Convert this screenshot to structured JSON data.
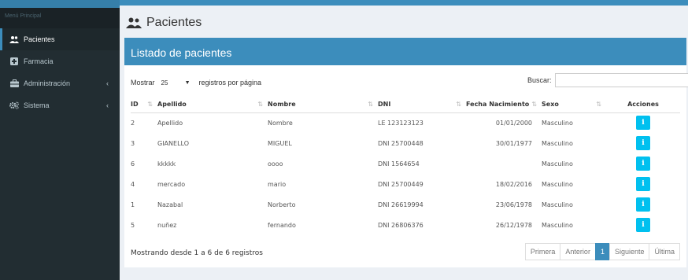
{
  "sidebar": {
    "header": "Menú Principal",
    "items": [
      {
        "label": "Pacientes",
        "icon": "users-icon",
        "active": true
      },
      {
        "label": "Farmacia",
        "icon": "plus-square-icon"
      },
      {
        "label": "Administración",
        "icon": "briefcase-icon",
        "chevron": "‹"
      },
      {
        "label": "Sistema",
        "icon": "cogs-icon",
        "chevron": "‹"
      }
    ]
  },
  "page": {
    "title": "Pacientes"
  },
  "box": {
    "title": "Listado de pacientes"
  },
  "length": {
    "prefix": "Mostrar",
    "value": "25",
    "suffix": "registros por página"
  },
  "search": {
    "label": "Buscar:",
    "value": ""
  },
  "table": {
    "headers": [
      "ID",
      "Apellido",
      "Nombre",
      "DNI",
      "Fecha Nacimiento",
      "Sexo",
      "Acciones"
    ],
    "rows": [
      [
        "2",
        "Apellido",
        "Nombre",
        "LE 123123123",
        "01/01/2000",
        "Masculino"
      ],
      [
        "3",
        "GIANELLO",
        "MIGUEL",
        "DNI 25700448",
        "30/01/1977",
        "Masculino"
      ],
      [
        "6",
        "kkkkk",
        "oooo",
        "DNI 1564654",
        "",
        "Masculino"
      ],
      [
        "4",
        "mercado",
        "mario",
        "DNI 25700449",
        "18/02/2016",
        "Masculino"
      ],
      [
        "1",
        "Nazabal",
        "Norberto",
        "DNI 26619994",
        "23/06/1978",
        "Masculino"
      ],
      [
        "5",
        "nuñez",
        "fernando",
        "DNI 26806376",
        "26/12/1978",
        "Masculino"
      ]
    ],
    "action_label": "i"
  },
  "footer": {
    "info": "Mostrando desde 1 a 6 de 6 registros"
  },
  "pagination": {
    "first": "Primera",
    "prev": "Anterior",
    "current": "1",
    "next": "Siguiente",
    "last": "Última"
  },
  "colors": {
    "accent": "#3c8dbc",
    "sidebar": "#222d32",
    "info_button": "#00c0ef"
  }
}
